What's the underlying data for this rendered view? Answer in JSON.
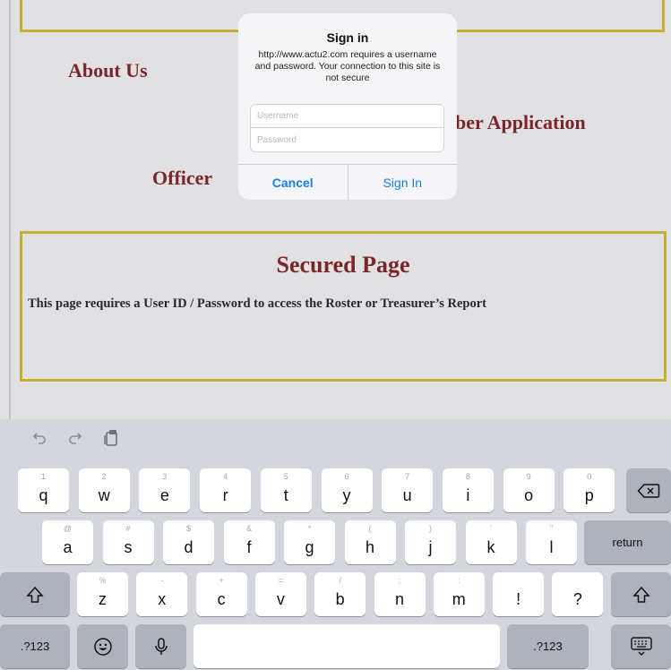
{
  "page": {
    "nav_about": "About Us",
    "nav_member": "ber Application",
    "nav_officers": "Officer",
    "secured_title": "Secured Page",
    "secured_desc": "This page requires a User ID / Password to access the Roster or Treasurer’s Report"
  },
  "dialog": {
    "title": "Sign in",
    "message": "http://www.actu2.com requires a username and password. Your connection to this site is not secure",
    "username_placeholder": "Username",
    "password_placeholder": "Password",
    "cancel_label": "Cancel",
    "signin_label": "Sign In",
    "link_color": "#1a7fe0"
  },
  "keyboard": {
    "toolbar": [
      "undo-icon",
      "redo-icon",
      "clipboard-icon"
    ],
    "row1": [
      {
        "label": "q",
        "hint": "1"
      },
      {
        "label": "w",
        "hint": "2"
      },
      {
        "label": "e",
        "hint": "3"
      },
      {
        "label": "r",
        "hint": "4"
      },
      {
        "label": "t",
        "hint": "5"
      },
      {
        "label": "y",
        "hint": "6"
      },
      {
        "label": "u",
        "hint": "7"
      },
      {
        "label": "i",
        "hint": "8"
      },
      {
        "label": "o",
        "hint": "9"
      },
      {
        "label": "p",
        "hint": "0"
      }
    ],
    "row2": [
      {
        "label": "a",
        "hint": "@"
      },
      {
        "label": "s",
        "hint": "#"
      },
      {
        "label": "d",
        "hint": "$"
      },
      {
        "label": "f",
        "hint": "&"
      },
      {
        "label": "g",
        "hint": "*"
      },
      {
        "label": "h",
        "hint": "("
      },
      {
        "label": "j",
        "hint": ")"
      },
      {
        "label": "k",
        "hint": "'"
      },
      {
        "label": "l",
        "hint": "\""
      }
    ],
    "row3": [
      {
        "label": "z",
        "hint": "%"
      },
      {
        "label": "x",
        "hint": "-"
      },
      {
        "label": "c",
        "hint": "+"
      },
      {
        "label": "v",
        "hint": "="
      },
      {
        "label": "b",
        "hint": "/"
      },
      {
        "label": "n",
        "hint": ";"
      },
      {
        "label": "m",
        "hint": ":"
      },
      {
        "label": "!",
        "hint": ""
      },
      {
        "label": "?",
        "hint": ""
      }
    ],
    "return_label": "return",
    "numbers_label": ".?123"
  },
  "colors": {
    "heading": "#7a1010",
    "border_gold": "#d9c21c",
    "keyboard_bg": "#d3d6dd"
  }
}
